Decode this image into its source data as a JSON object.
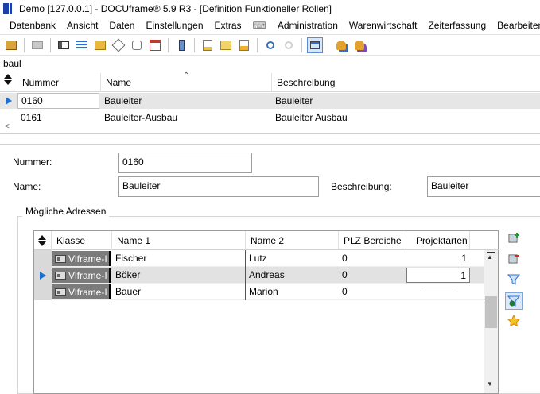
{
  "window": {
    "title": "Demo [127.0.0.1] - DOCUframe® 5.9 R3 - [Definition Funktioneller Rollen]"
  },
  "menu": {
    "items": [
      {
        "label": "Datenbank"
      },
      {
        "label": "Ansicht"
      },
      {
        "label": "Daten"
      },
      {
        "label": "Einstellungen"
      },
      {
        "label": "Extras"
      },
      {
        "label": "Administration"
      },
      {
        "label": "Warenwirtschaft"
      },
      {
        "label": "Zeiterfassung"
      },
      {
        "label": "Bearbeiten"
      }
    ]
  },
  "toolbar": {
    "buttons": [
      "new-record-icon",
      "print-icon",
      "card-icon",
      "list-icon",
      "folder-icon",
      "tag-icon",
      "attach-icon",
      "calendar-icon",
      "phone-icon",
      "document-new-icon",
      "document-edit-icon",
      "document-export-icon",
      "find-icon",
      "find-disabled-icon",
      "view-form-icon",
      "user-assign-icon",
      "user-group-icon"
    ]
  },
  "search": {
    "value": "baul"
  },
  "main_grid": {
    "columns": [
      "Nummer",
      "Name",
      "Beschreibung"
    ],
    "rows": [
      {
        "nummer": "0160",
        "name": "Bauleiter",
        "beschreibung": "Bauleiter"
      },
      {
        "nummer": "0161",
        "name": "Bauleiter-Ausbau",
        "beschreibung": "Bauleiter Ausbau"
      }
    ]
  },
  "form": {
    "nummer_label": "Nummer:",
    "nummer_value": "0160",
    "name_label": "Name:",
    "name_value": "Bauleiter",
    "beschreibung_label": "Beschreibung:",
    "beschreibung_value": "Bauleiter"
  },
  "adressen": {
    "group_title": "Mögliche Adressen",
    "columns": [
      "Klasse",
      "Name 1",
      "Name 2",
      "PLZ Bereiche",
      "Projektarten"
    ],
    "rows": [
      {
        "klasse": "Vlframe-I",
        "name1": "Fischer",
        "name2": "Lutz",
        "plz": "0",
        "projektarten": "1"
      },
      {
        "klasse": "Vlframe-I",
        "name1": "Böker",
        "name2": "Andreas",
        "plz": "0",
        "projektarten": "1"
      },
      {
        "klasse": "Vlframe-I",
        "name1": "Bauer",
        "name2": "Marion",
        "plz": "0",
        "projektarten": ""
      }
    ]
  },
  "side_buttons": [
    "add-row-icon",
    "remove-row-icon",
    "filter-icon",
    "filter-clear-icon",
    "favorite-star-icon"
  ]
}
